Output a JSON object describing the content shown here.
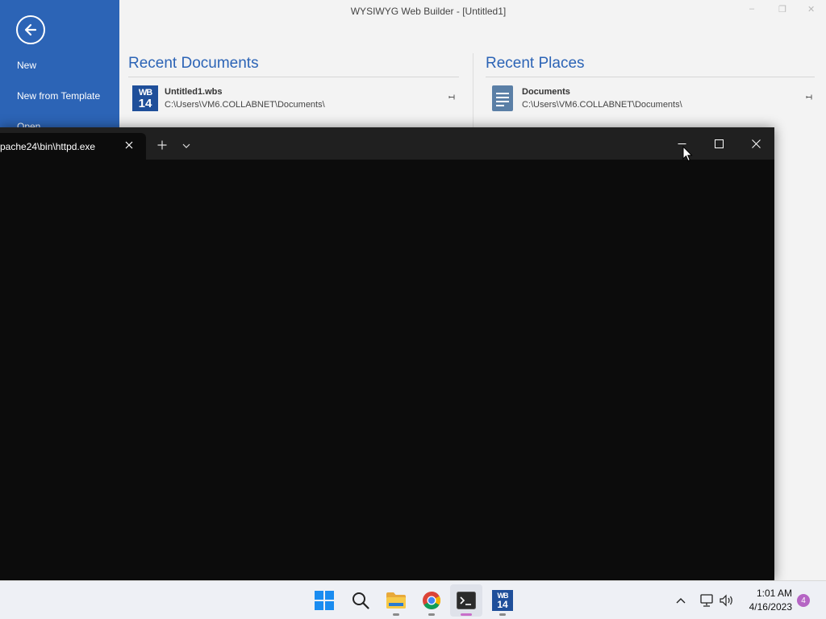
{
  "app": {
    "title": "WYSIWYG Web Builder - [Untitled1]",
    "window_controls": {
      "minimize": "–",
      "restore": "❐",
      "close": "✕"
    },
    "sidebar": {
      "items": [
        {
          "label": "New"
        },
        {
          "label": "New from Template"
        },
        {
          "label": "Open"
        }
      ]
    },
    "recent_documents": {
      "title": "Recent Documents",
      "items": [
        {
          "name": "Untitled1.wbs",
          "path": "C:\\Users\\VM6.COLLABNET\\Documents\\",
          "icon": "wb14-logo-icon"
        }
      ]
    },
    "recent_places": {
      "title": "Recent Places",
      "items": [
        {
          "name": "Documents",
          "path": "C:\\Users\\VM6.COLLABNET\\Documents\\",
          "icon": "document-folder-icon"
        }
      ]
    },
    "logo_text": {
      "line1": "WB",
      "line2": "14"
    },
    "accent_color": "#2c64b6"
  },
  "terminal": {
    "tab_title": "pache24\\bin\\httpd.exe",
    "background_color": "#0c0c0c",
    "titlebar_color": "#202020"
  },
  "taskbar": {
    "apps": [
      {
        "name": "start",
        "icon": "windows-logo-icon"
      },
      {
        "name": "search",
        "icon": "search-icon"
      },
      {
        "name": "file-explorer",
        "icon": "folder-icon",
        "running": true
      },
      {
        "name": "chrome",
        "icon": "chrome-icon",
        "running": true
      },
      {
        "name": "terminal",
        "icon": "terminal-icon",
        "running": true,
        "active": true
      },
      {
        "name": "wysiwyg-web-builder",
        "icon": "wb14-logo-icon",
        "running": true
      }
    ],
    "clock": {
      "time": "1:01 AM",
      "date": "4/16/2023"
    },
    "notifications": {
      "count": "4"
    }
  }
}
